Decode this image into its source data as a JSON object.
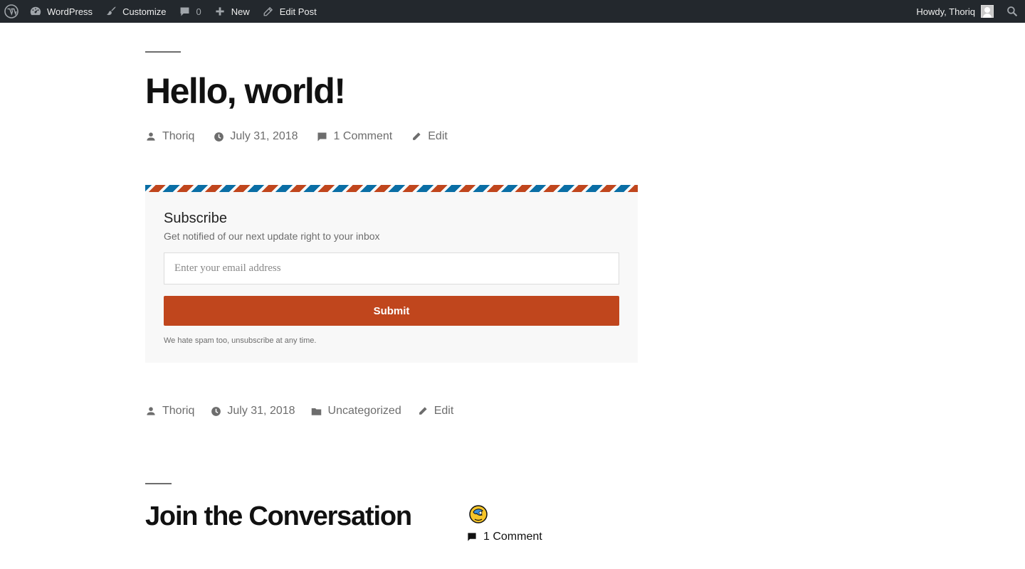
{
  "adminbar": {
    "site_label": "WordPress",
    "customize_label": "Customize",
    "comments_count": "0",
    "new_label": "New",
    "edit_post_label": "Edit Post",
    "howdy_label": "Howdy, Thoriq"
  },
  "post": {
    "title": "Hello, world!",
    "meta_top": {
      "author": "Thoriq",
      "date": "July 31, 2018",
      "comments": "1 Comment",
      "edit": "Edit"
    },
    "meta_bottom": {
      "author": "Thoriq",
      "date": "July 31, 2018",
      "category": "Uncategorized",
      "edit": "Edit"
    }
  },
  "subscribe": {
    "title": "Subscribe",
    "description": "Get notified of our next update right to your inbox",
    "email_placeholder": "Enter your email address",
    "email_value": "",
    "submit_label": "Submit",
    "note": "We hate spam too, unsubscribe at any time."
  },
  "comments_section": {
    "title": "Join the Conversation",
    "count_label": "1 Comment"
  },
  "colors": {
    "accent": "#c0461d",
    "stripe_blue": "#0a6ea5",
    "adminbar_bg": "#23282d",
    "meta_text": "#6d6d6d"
  }
}
